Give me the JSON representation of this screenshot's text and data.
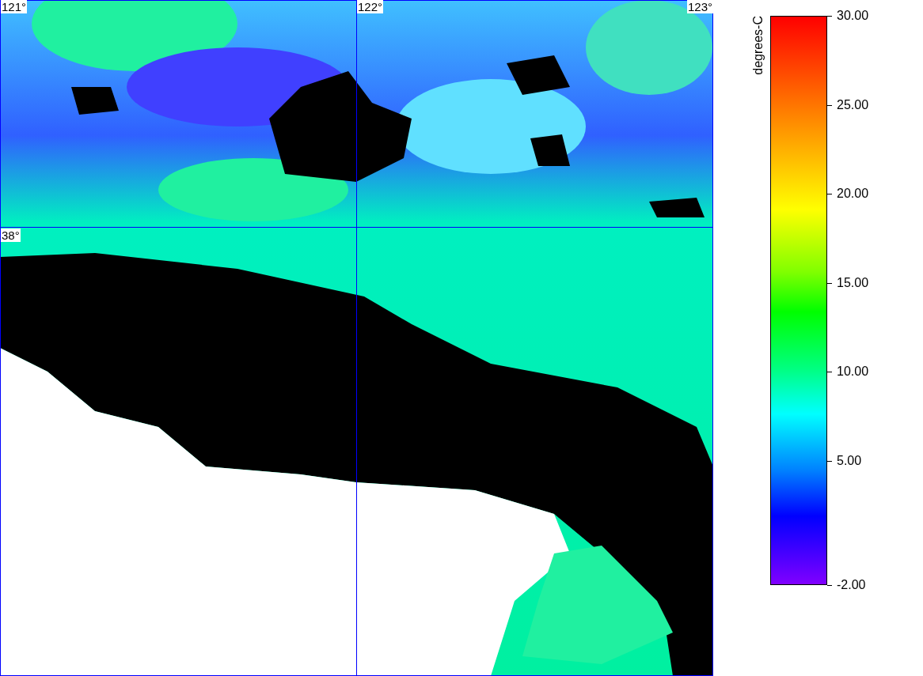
{
  "map": {
    "lon_labels": [
      "121°",
      "122°",
      "123°"
    ],
    "lat_labels": [
      "38°"
    ]
  },
  "legend": {
    "title": "degrees-C",
    "ticks": [
      {
        "label": "30.00"
      },
      {
        "label": "25.00"
      },
      {
        "label": "20.00"
      },
      {
        "label": "15.00"
      },
      {
        "label": "10.00"
      },
      {
        "label": "5.00"
      },
      {
        "label": "-2.00"
      }
    ]
  }
}
